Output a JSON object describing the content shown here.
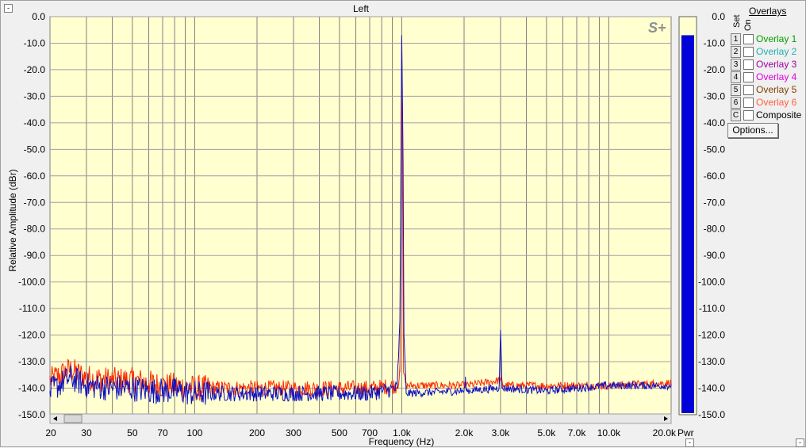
{
  "window": {
    "title": "Left"
  },
  "chart_data": {
    "type": "line",
    "title": "Left",
    "xlabel": "Frequency (Hz)",
    "ylabel": "Relative Amplitude (dBr)",
    "xscale": "log",
    "xlim": [
      20,
      20000
    ],
    "ylim": [
      -150,
      0
    ],
    "grid": true,
    "yticks": [
      "0.0",
      "-10.0",
      "-20.0",
      "-30.0",
      "-40.0",
      "-50.0",
      "-60.0",
      "-70.0",
      "-80.0",
      "-90.0",
      "-100.0",
      "-110.0",
      "-120.0",
      "-130.0",
      "-140.0",
      "-150.0"
    ],
    "xtick_labels": [
      {
        "f": 20,
        "label": "20"
      },
      {
        "f": 30,
        "label": "30"
      },
      {
        "f": 50,
        "label": "50"
      },
      {
        "f": 70,
        "label": "70"
      },
      {
        "f": 100,
        "label": "100"
      },
      {
        "f": 200,
        "label": "200"
      },
      {
        "f": 300,
        "label": "300"
      },
      {
        "f": 500,
        "label": "500"
      },
      {
        "f": 700,
        "label": "700"
      },
      {
        "f": 1000,
        "label": "1.0k"
      },
      {
        "f": 2000,
        "label": "2.0k"
      },
      {
        "f": 3000,
        "label": "3.0k"
      },
      {
        "f": 5000,
        "label": "5.0k"
      },
      {
        "f": 7000,
        "label": "7.0k"
      },
      {
        "f": 10000,
        "label": "10.0k"
      },
      {
        "f": 20000,
        "label": "20.0k"
      }
    ],
    "series": [
      {
        "color": "#ff2a00",
        "points": [
          [
            20,
            -137
          ],
          [
            25,
            -133
          ],
          [
            30,
            -136
          ],
          [
            40,
            -137
          ],
          [
            50,
            -137
          ],
          [
            60,
            -138
          ],
          [
            70,
            -139
          ],
          [
            80,
            -139
          ],
          [
            100,
            -140
          ],
          [
            200,
            -140
          ],
          [
            300,
            -140
          ],
          [
            500,
            -140
          ],
          [
            700,
            -140
          ],
          [
            950,
            -139
          ],
          [
            980,
            -134
          ],
          [
            1000,
            -8
          ],
          [
            1020,
            -134
          ],
          [
            1050,
            -139
          ],
          [
            2000,
            -139
          ],
          [
            2050,
            -139
          ],
          [
            3000,
            -137
          ],
          [
            3100,
            -139
          ],
          [
            5000,
            -139
          ],
          [
            7000,
            -139
          ],
          [
            10000,
            -139
          ],
          [
            20000,
            -138
          ]
        ]
      },
      {
        "color": "#1010c0",
        "points": [
          [
            20,
            -141
          ],
          [
            25,
            -136
          ],
          [
            30,
            -139
          ],
          [
            40,
            -140
          ],
          [
            50,
            -140
          ],
          [
            60,
            -141
          ],
          [
            70,
            -141
          ],
          [
            80,
            -141
          ],
          [
            100,
            -142
          ],
          [
            200,
            -142
          ],
          [
            300,
            -142
          ],
          [
            500,
            -142
          ],
          [
            700,
            -142
          ],
          [
            950,
            -140
          ],
          [
            980,
            -114
          ],
          [
            1000,
            -7
          ],
          [
            1015,
            -55
          ],
          [
            1025,
            -120
          ],
          [
            1050,
            -142
          ],
          [
            2000,
            -141
          ],
          [
            2030,
            -137
          ],
          [
            2060,
            -141
          ],
          [
            2950,
            -140
          ],
          [
            3000,
            -118
          ],
          [
            3050,
            -140
          ],
          [
            5000,
            -141
          ],
          [
            7000,
            -140
          ],
          [
            10000,
            -139
          ],
          [
            20000,
            -139
          ]
        ]
      }
    ],
    "pwr_meter": {
      "label": "Pwr",
      "value_dbr": -7,
      "scale_top": "0.0"
    }
  },
  "overlays": {
    "title": "Overlays",
    "col_set": "Set",
    "col_on": "On",
    "items": [
      {
        "num": "1",
        "label": "Overlay 1",
        "color": "#00a000"
      },
      {
        "num": "2",
        "label": "Overlay 2",
        "color": "#20b0b0"
      },
      {
        "num": "3",
        "label": "Overlay 3",
        "color": "#a000a0"
      },
      {
        "num": "4",
        "label": "Overlay 4",
        "color": "#e000e0"
      },
      {
        "num": "5",
        "label": "Overlay 5",
        "color": "#804000"
      },
      {
        "num": "6",
        "label": "Overlay 6",
        "color": "#ff6040"
      },
      {
        "num": "C",
        "label": "Composite",
        "color": "#000000"
      }
    ],
    "options_label": "Options..."
  },
  "icons": {
    "minimize": "minimize-icon",
    "scroll_left": "arrow-left-icon",
    "scroll_right": "arrow-right-icon",
    "logo": "s-plus-logo"
  },
  "logo_text": "S+",
  "minimize_glyph": "-"
}
